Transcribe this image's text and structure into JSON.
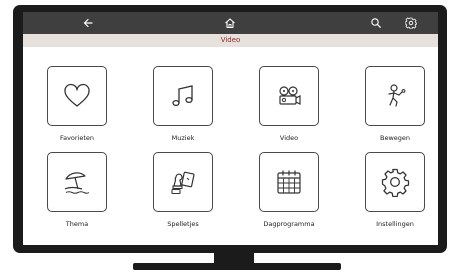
{
  "header": {
    "back_icon": "arrow-left-icon",
    "home_icon": "home-icon",
    "search_icon": "search-icon",
    "settings_icon": "gear-icon"
  },
  "subheader": {
    "title": "Video"
  },
  "tiles": [
    {
      "label": "Favorieten",
      "icon": "heart-icon"
    },
    {
      "label": "Muziek",
      "icon": "music-note-icon"
    },
    {
      "label": "Video",
      "icon": "film-projector-icon"
    },
    {
      "label": "Bewegen",
      "icon": "person-exercising-icon"
    },
    {
      "label": "Thema",
      "icon": "beach-umbrella-icon"
    },
    {
      "label": "Spelletjes",
      "icon": "game-pieces-icon"
    },
    {
      "label": "Dagprogramma",
      "icon": "calendar-icon"
    },
    {
      "label": "Instellingen",
      "icon": "gear-icon"
    }
  ],
  "colors": {
    "header_bg": "#3f3f3f",
    "subheader_bg": "#e7e1dd",
    "subheader_text": "#8f2a25",
    "frame": "#1b1b1b"
  }
}
